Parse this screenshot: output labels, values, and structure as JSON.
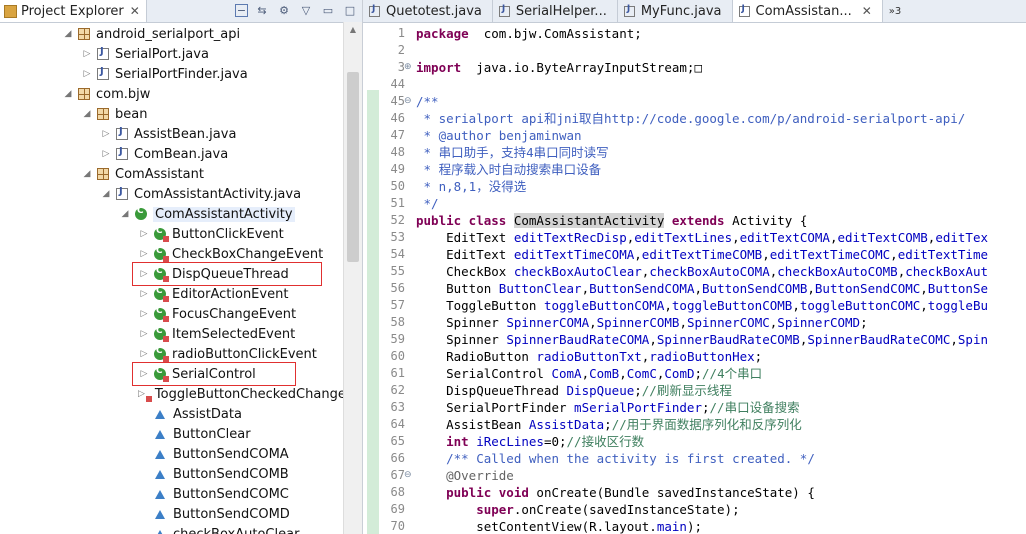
{
  "explorer": {
    "title": "Project Explorer",
    "items": [
      {
        "label": "android_serialport_api",
        "icon": "package-icon",
        "depth": 4,
        "twisty": "open"
      },
      {
        "label": "SerialPort.java",
        "icon": "java-file-icon",
        "depth": 5,
        "twisty": "closed"
      },
      {
        "label": "SerialPortFinder.java",
        "icon": "java-file-icon",
        "depth": 5,
        "twisty": "closed"
      },
      {
        "label": "com.bjw",
        "icon": "package-icon",
        "depth": 4,
        "twisty": "open"
      },
      {
        "label": "bean",
        "icon": "package-icon",
        "depth": 5,
        "twisty": "open"
      },
      {
        "label": "AssistBean.java",
        "icon": "java-file-icon",
        "depth": 6,
        "twisty": "closed"
      },
      {
        "label": "ComBean.java",
        "icon": "java-file-icon",
        "depth": 6,
        "twisty": "closed"
      },
      {
        "label": "ComAssistant",
        "icon": "package-icon",
        "depth": 5,
        "twisty": "open"
      },
      {
        "label": "ComAssistantActivity.java",
        "icon": "java-file-icon",
        "depth": 6,
        "twisty": "open"
      },
      {
        "label": "ComAssistantActivity",
        "icon": "class-icon",
        "depth": 7,
        "twisty": "open",
        "selected": true
      },
      {
        "label": "ButtonClickEvent",
        "icon": "inner-class-icon",
        "depth": 8,
        "twisty": "closed"
      },
      {
        "label": "CheckBoxChangeEvent",
        "icon": "inner-class-icon",
        "depth": 8,
        "twisty": "closed"
      },
      {
        "label": "DispQueueThread",
        "icon": "inner-class-icon",
        "depth": 8,
        "twisty": "closed",
        "highlight": true
      },
      {
        "label": "EditorActionEvent",
        "icon": "inner-class-icon",
        "depth": 8,
        "twisty": "closed"
      },
      {
        "label": "FocusChangeEvent",
        "icon": "inner-class-icon",
        "depth": 8,
        "twisty": "closed"
      },
      {
        "label": "ItemSelectedEvent",
        "icon": "inner-class-icon",
        "depth": 8,
        "twisty": "closed"
      },
      {
        "label": "radioButtonClickEvent",
        "icon": "inner-class-icon",
        "depth": 8,
        "twisty": "closed"
      },
      {
        "label": "SerialControl",
        "icon": "inner-class-icon",
        "depth": 8,
        "twisty": "closed",
        "highlight": true
      },
      {
        "label": "ToggleButtonCheckedChange",
        "icon": "inner-class-icon",
        "depth": 8,
        "twisty": "closed"
      },
      {
        "label": "AssistData",
        "icon": "field-icon",
        "depth": 8,
        "twisty": "none"
      },
      {
        "label": "ButtonClear",
        "icon": "field-icon",
        "depth": 8,
        "twisty": "none"
      },
      {
        "label": "ButtonSendCOMA",
        "icon": "field-icon",
        "depth": 8,
        "twisty": "none"
      },
      {
        "label": "ButtonSendCOMB",
        "icon": "field-icon",
        "depth": 8,
        "twisty": "none"
      },
      {
        "label": "ButtonSendCOMC",
        "icon": "field-icon",
        "depth": 8,
        "twisty": "none"
      },
      {
        "label": "ButtonSendCOMD",
        "icon": "field-icon",
        "depth": 8,
        "twisty": "none"
      },
      {
        "label": "checkBoxAutoClear",
        "icon": "field-icon",
        "depth": 8,
        "twisty": "none"
      }
    ]
  },
  "editor": {
    "tabs": [
      {
        "label": "Quetotest.java",
        "active": false
      },
      {
        "label": "SerialHelper...",
        "active": false
      },
      {
        "label": "MyFunc.java",
        "active": false
      },
      {
        "label": "ComAssistan...",
        "active": true
      }
    ],
    "overflow_label": "»3",
    "lines": [
      {
        "n": "1",
        "fold": "",
        "segs": [
          [
            "kw",
            "package"
          ],
          [
            "",
            "  com.bjw.ComAssistant;"
          ]
        ]
      },
      {
        "n": "2",
        "fold": "",
        "segs": []
      },
      {
        "n": "3",
        "fold": "⊕",
        "segs": [
          [
            "kw",
            "import"
          ],
          [
            "",
            "  java.io.ByteArrayInputStream;"
          ],
          [
            "",
            "□"
          ]
        ]
      },
      {
        "n": "44",
        "fold": "",
        "segs": []
      },
      {
        "n": "45",
        "fold": "⊖",
        "segs": [
          [
            "jd",
            "/**"
          ]
        ]
      },
      {
        "n": "46",
        "fold": "",
        "segs": [
          [
            "jd",
            " * serialport api"
          ],
          [
            "jd cjk",
            "和"
          ],
          [
            "jd",
            "jni"
          ],
          [
            "jd cjk",
            "取自"
          ],
          [
            "jd",
            "http://code.google.com/p/android-serialport-api/"
          ]
        ]
      },
      {
        "n": "47",
        "fold": "",
        "segs": [
          [
            "jd",
            " * @author benjaminwan"
          ]
        ]
      },
      {
        "n": "48",
        "fold": "",
        "segs": [
          [
            "jd",
            " * "
          ],
          [
            "jd cjk",
            "串口助手，支持"
          ],
          [
            "jd",
            "4"
          ],
          [
            "jd cjk",
            "串口同时读写"
          ]
        ]
      },
      {
        "n": "49",
        "fold": "",
        "segs": [
          [
            "jd",
            " * "
          ],
          [
            "jd cjk",
            "程序载入时自动搜索串口设备"
          ]
        ]
      },
      {
        "n": "50",
        "fold": "",
        "segs": [
          [
            "jd",
            " * n,8,1"
          ],
          [
            "jd cjk",
            "，没得选"
          ]
        ]
      },
      {
        "n": "51",
        "fold": "",
        "segs": [
          [
            "jd",
            " */"
          ]
        ]
      },
      {
        "n": "52",
        "fold": "",
        "segs": [
          [
            "kw",
            "public class "
          ],
          [
            "sel",
            "ComAssistantActivity"
          ],
          [
            "kw",
            " extends"
          ],
          [
            "",
            " Activity {"
          ]
        ]
      },
      {
        "n": "53",
        "fold": "",
        "segs": [
          [
            "",
            "    EditText "
          ],
          [
            "fd",
            "editTextRecDisp"
          ],
          [
            "",
            ","
          ],
          [
            "fd",
            "editTextLines"
          ],
          [
            "",
            ","
          ],
          [
            "fd",
            "editTextCOMA"
          ],
          [
            "",
            ","
          ],
          [
            "fd",
            "editTextCOMB"
          ],
          [
            "",
            ","
          ],
          [
            "fd",
            "editTex"
          ]
        ]
      },
      {
        "n": "54",
        "fold": "",
        "segs": [
          [
            "",
            "    EditText "
          ],
          [
            "fd",
            "editTextTimeCOMA"
          ],
          [
            "",
            ","
          ],
          [
            "fd",
            "editTextTimeCOMB"
          ],
          [
            "",
            ","
          ],
          [
            "fd",
            "editTextTimeCOMC"
          ],
          [
            "",
            ","
          ],
          [
            "fd",
            "editTextTime"
          ]
        ]
      },
      {
        "n": "55",
        "fold": "",
        "segs": [
          [
            "",
            "    CheckBox "
          ],
          [
            "fd",
            "checkBoxAutoClear"
          ],
          [
            "",
            ","
          ],
          [
            "fd",
            "checkBoxAutoCOMA"
          ],
          [
            "",
            ","
          ],
          [
            "fd",
            "checkBoxAutoCOMB"
          ],
          [
            "",
            ","
          ],
          [
            "fd",
            "checkBoxAut"
          ]
        ]
      },
      {
        "n": "56",
        "fold": "",
        "segs": [
          [
            "",
            "    Button "
          ],
          [
            "fd",
            "ButtonClear"
          ],
          [
            "",
            ","
          ],
          [
            "fd",
            "ButtonSendCOMA"
          ],
          [
            "",
            ","
          ],
          [
            "fd",
            "ButtonSendCOMB"
          ],
          [
            "",
            ","
          ],
          [
            "fd",
            "ButtonSendCOMC"
          ],
          [
            "",
            ","
          ],
          [
            "fd",
            "ButtonSe"
          ]
        ]
      },
      {
        "n": "57",
        "fold": "",
        "segs": [
          [
            "",
            "    ToggleButton "
          ],
          [
            "fd",
            "toggleButtonCOMA"
          ],
          [
            "",
            ","
          ],
          [
            "fd",
            "toggleButtonCOMB"
          ],
          [
            "",
            ","
          ],
          [
            "fd",
            "toggleButtonCOMC"
          ],
          [
            "",
            ","
          ],
          [
            "fd",
            "toggleBu"
          ]
        ]
      },
      {
        "n": "58",
        "fold": "",
        "segs": [
          [
            "",
            "    Spinner "
          ],
          [
            "fd",
            "SpinnerCOMA"
          ],
          [
            "",
            ","
          ],
          [
            "fd",
            "SpinnerCOMB"
          ],
          [
            "",
            ","
          ],
          [
            "fd",
            "SpinnerCOMC"
          ],
          [
            "",
            ","
          ],
          [
            "fd",
            "SpinnerCOMD"
          ],
          [
            "",
            ";"
          ]
        ]
      },
      {
        "n": "59",
        "fold": "",
        "segs": [
          [
            "",
            "    Spinner "
          ],
          [
            "fd",
            "SpinnerBaudRateCOMA"
          ],
          [
            "",
            ","
          ],
          [
            "fd",
            "SpinnerBaudRateCOMB"
          ],
          [
            "",
            ","
          ],
          [
            "fd",
            "SpinnerBaudRateCOMC"
          ],
          [
            "",
            ","
          ],
          [
            "fd",
            "Spin"
          ]
        ]
      },
      {
        "n": "60",
        "fold": "",
        "segs": [
          [
            "",
            "    RadioButton "
          ],
          [
            "fd",
            "radioButtonTxt"
          ],
          [
            "",
            ","
          ],
          [
            "fd",
            "radioButtonHex"
          ],
          [
            "",
            ";"
          ]
        ]
      },
      {
        "n": "61",
        "fold": "",
        "segs": [
          [
            "",
            "    SerialControl "
          ],
          [
            "fd",
            "ComA"
          ],
          [
            "",
            ","
          ],
          [
            "fd",
            "ComB"
          ],
          [
            "",
            ","
          ],
          [
            "fd",
            "ComC"
          ],
          [
            "",
            ","
          ],
          [
            "fd",
            "ComD"
          ],
          [
            "",
            ";"
          ],
          [
            "cm",
            "//4"
          ],
          [
            "cm cjk",
            "个串口"
          ]
        ]
      },
      {
        "n": "62",
        "fold": "",
        "segs": [
          [
            "",
            "    DispQueueThread "
          ],
          [
            "fd",
            "DispQueue"
          ],
          [
            "",
            ";"
          ],
          [
            "cm",
            "//"
          ],
          [
            "cm cjk",
            "刷新显示线程"
          ]
        ]
      },
      {
        "n": "63",
        "fold": "",
        "segs": [
          [
            "",
            "    SerialPortFinder "
          ],
          [
            "fd",
            "mSerialPortFinder"
          ],
          [
            "",
            ";"
          ],
          [
            "cm",
            "//"
          ],
          [
            "cm cjk",
            "串口设备搜索"
          ]
        ]
      },
      {
        "n": "64",
        "fold": "",
        "segs": [
          [
            "",
            "    AssistBean "
          ],
          [
            "fd",
            "AssistData"
          ],
          [
            "",
            ";"
          ],
          [
            "cm",
            "//"
          ],
          [
            "cm cjk",
            "用于界面数据序列化和反序列化"
          ]
        ]
      },
      {
        "n": "65",
        "fold": "",
        "segs": [
          [
            "kw",
            "    int "
          ],
          [
            "fd",
            "iRecLines"
          ],
          [
            "",
            "=0;"
          ],
          [
            "cm",
            "//"
          ],
          [
            "cm cjk",
            "接收区行数"
          ]
        ]
      },
      {
        "n": "66",
        "fold": "",
        "segs": [
          [
            "jd",
            "    /** Called when the activity is first created. */"
          ]
        ]
      },
      {
        "n": "67",
        "fold": "⊖",
        "segs": [
          [
            "ann",
            "    @Override"
          ]
        ]
      },
      {
        "n": "68",
        "fold": "",
        "segs": [
          [
            "kw",
            "    public void "
          ],
          [
            "",
            "onCreate(Bundle savedInstanceState) {"
          ]
        ]
      },
      {
        "n": "69",
        "fold": "",
        "segs": [
          [
            "kw",
            "        super"
          ],
          [
            "",
            ".onCreate(savedInstanceState);"
          ]
        ]
      },
      {
        "n": "70",
        "fold": "",
        "segs": [
          [
            "",
            "        setContentView(R.layout."
          ],
          [
            "fd",
            "main"
          ],
          [
            "",
            ");"
          ]
        ]
      }
    ]
  }
}
